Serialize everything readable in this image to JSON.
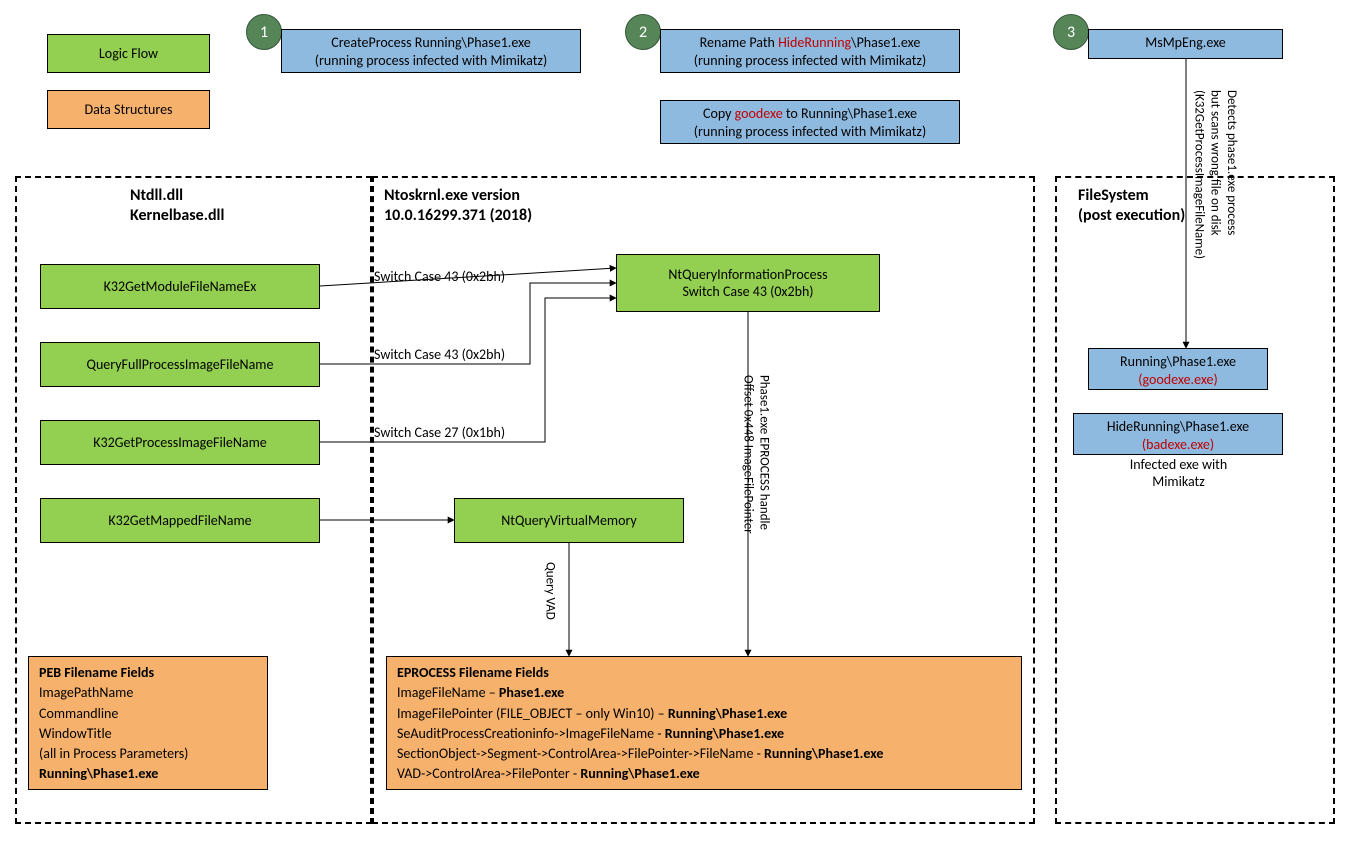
{
  "legend": {
    "logic_flow": "Logic Flow",
    "data_structures": "Data Structures"
  },
  "steps": {
    "s1_num": "1",
    "s1_l1": "CreateProcess Running\\Phase1.exe",
    "s1_l2": "(running process infected with Mimikatz)",
    "s2_num": "2",
    "s2a_l1_pre": "Rename Path ",
    "s2a_l1_red": "HideRunning",
    "s2a_l1_post": "\\Phase1.exe",
    "s2a_l2": "(running process infected with Mimikatz)",
    "s2b_l1_pre": "Copy ",
    "s2b_l1_red": "goodexe",
    "s2b_l1_post": " to Running\\Phase1.exe",
    "s2b_l2": "(running process infected with Mimikatz)",
    "s3_num": "3",
    "s3_label": "MsMpEng.exe"
  },
  "ntdll": {
    "title_l1": "Ntdll.dll",
    "title_l2": "Kernelbase.dll",
    "fn1": "K32GetModuleFileNameEx",
    "fn2": "QueryFullProcessImageFileName",
    "fn3": "K32GetProcessImageFileName",
    "fn4": "K32GetMappedFileName"
  },
  "ntoskrnl": {
    "title_l1": "Ntoskrnl.exe version",
    "title_l2": "10.0.16299.371 (2018)",
    "fn_query_l1": "NtQueryInformationProcess",
    "fn_query_l2": "Switch Case 43 (0x2bh)",
    "fn_vmem": "NtQueryVirtualMemory"
  },
  "edges": {
    "sw43": "Switch Case 43 (0x2bh)",
    "sw27": "Switch Case 27 (0x1bh)",
    "qvad": "Query VAD",
    "handle_l1": "Phase1.exe EPROCESS handle",
    "handle_l2": "Offset 0x448 ImageFilePointer",
    "detect_l1": "Detects phase1.exe process",
    "detect_l2": "but scans wrong file on disk",
    "detect_l3": "(K32GetProcessImageFileName)"
  },
  "peb": {
    "title": "PEB Filename Fields",
    "r1": "ImagePathName",
    "r2": "Commandline",
    "r3": "WindowTitle",
    "r4": "(all in Process Parameters)",
    "r5": "Running\\Phase1.exe"
  },
  "eproc": {
    "title": "EPROCESS Filename Fields",
    "r1a": "ImageFileName – ",
    "r1b": "Phase1.exe",
    "r2a": "ImageFilePointer (FILE_OBJECT – only Win10) – ",
    "r2b": "Running\\Phase1.exe",
    "r3a": "SeAuditProcessCreationinfo->ImageFileName - ",
    "r3b": "Running\\Phase1.exe",
    "r4a": "SectionObject->Segment->ControlArea->FilePointer->FileName - ",
    "r4b": "Running\\Phase1.exe",
    "r5a": "VAD->ControlArea->FilePonter - ",
    "r5b": "Running\\Phase1.exe"
  },
  "fs": {
    "title_l1": "FileSystem",
    "title_l2": "(post execution)",
    "good_l1": "Running\\Phase1.exe",
    "good_l2": "(goodexe.exe)",
    "bad_l1": "HideRunning\\Phase1.exe",
    "bad_l2": "(badexe.exe)",
    "bad_note_l1": "Infected exe with",
    "bad_note_l2": "Mimikatz"
  }
}
